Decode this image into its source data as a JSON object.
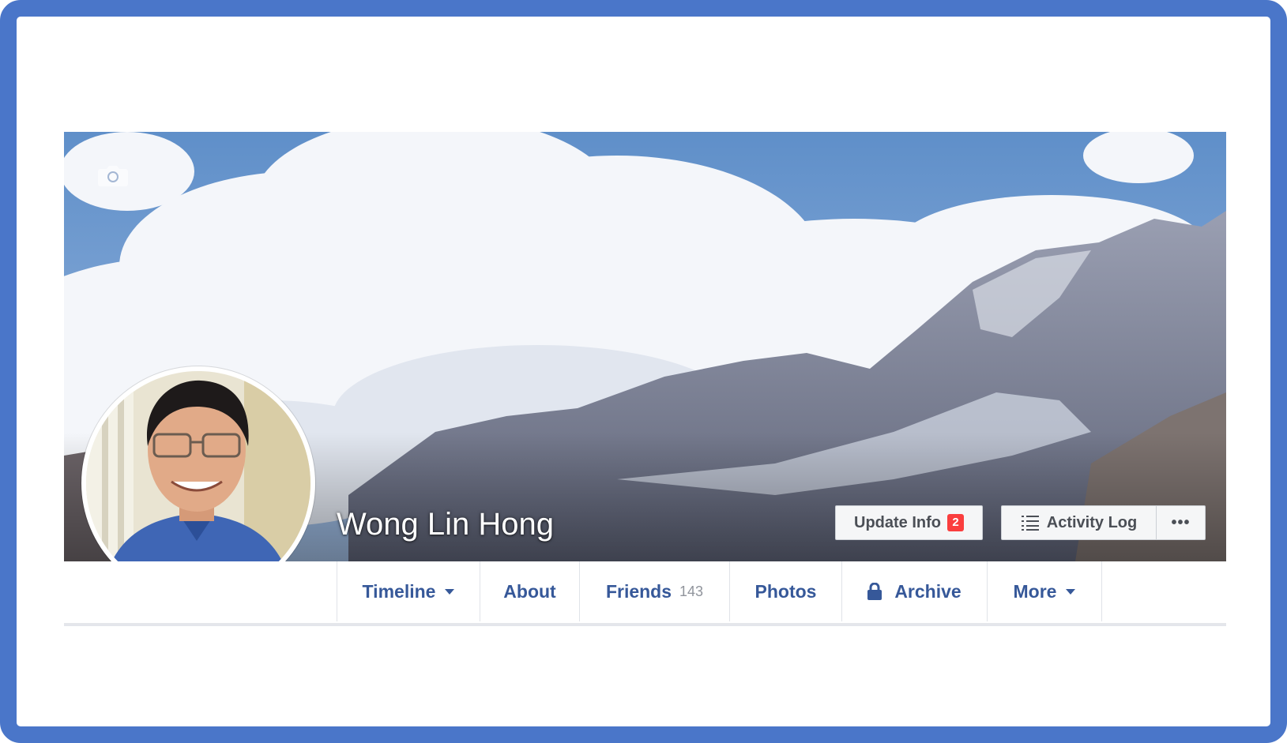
{
  "profile": {
    "name": "Wong Lin Hong",
    "update_info_label": "Update Info",
    "update_info_badge": "2",
    "activity_log_label": "Activity Log",
    "more_options_label": "•••"
  },
  "nav": {
    "tabs": [
      {
        "label": "Timeline",
        "has_caret": true
      },
      {
        "label": "About"
      },
      {
        "label": "Friends",
        "count": "143"
      },
      {
        "label": "Photos"
      },
      {
        "label": "Archive",
        "icon": "lock-icon"
      },
      {
        "label": "More",
        "has_caret": true
      }
    ]
  },
  "colors": {
    "frame_border": "#4a76c9",
    "nav_text": "#365899",
    "badge": "#fa3e3e"
  },
  "icons": {
    "cover_camera": "camera-icon",
    "activity_log": "list-icon",
    "archive": "lock-icon",
    "dropdown": "caret-down-icon"
  }
}
